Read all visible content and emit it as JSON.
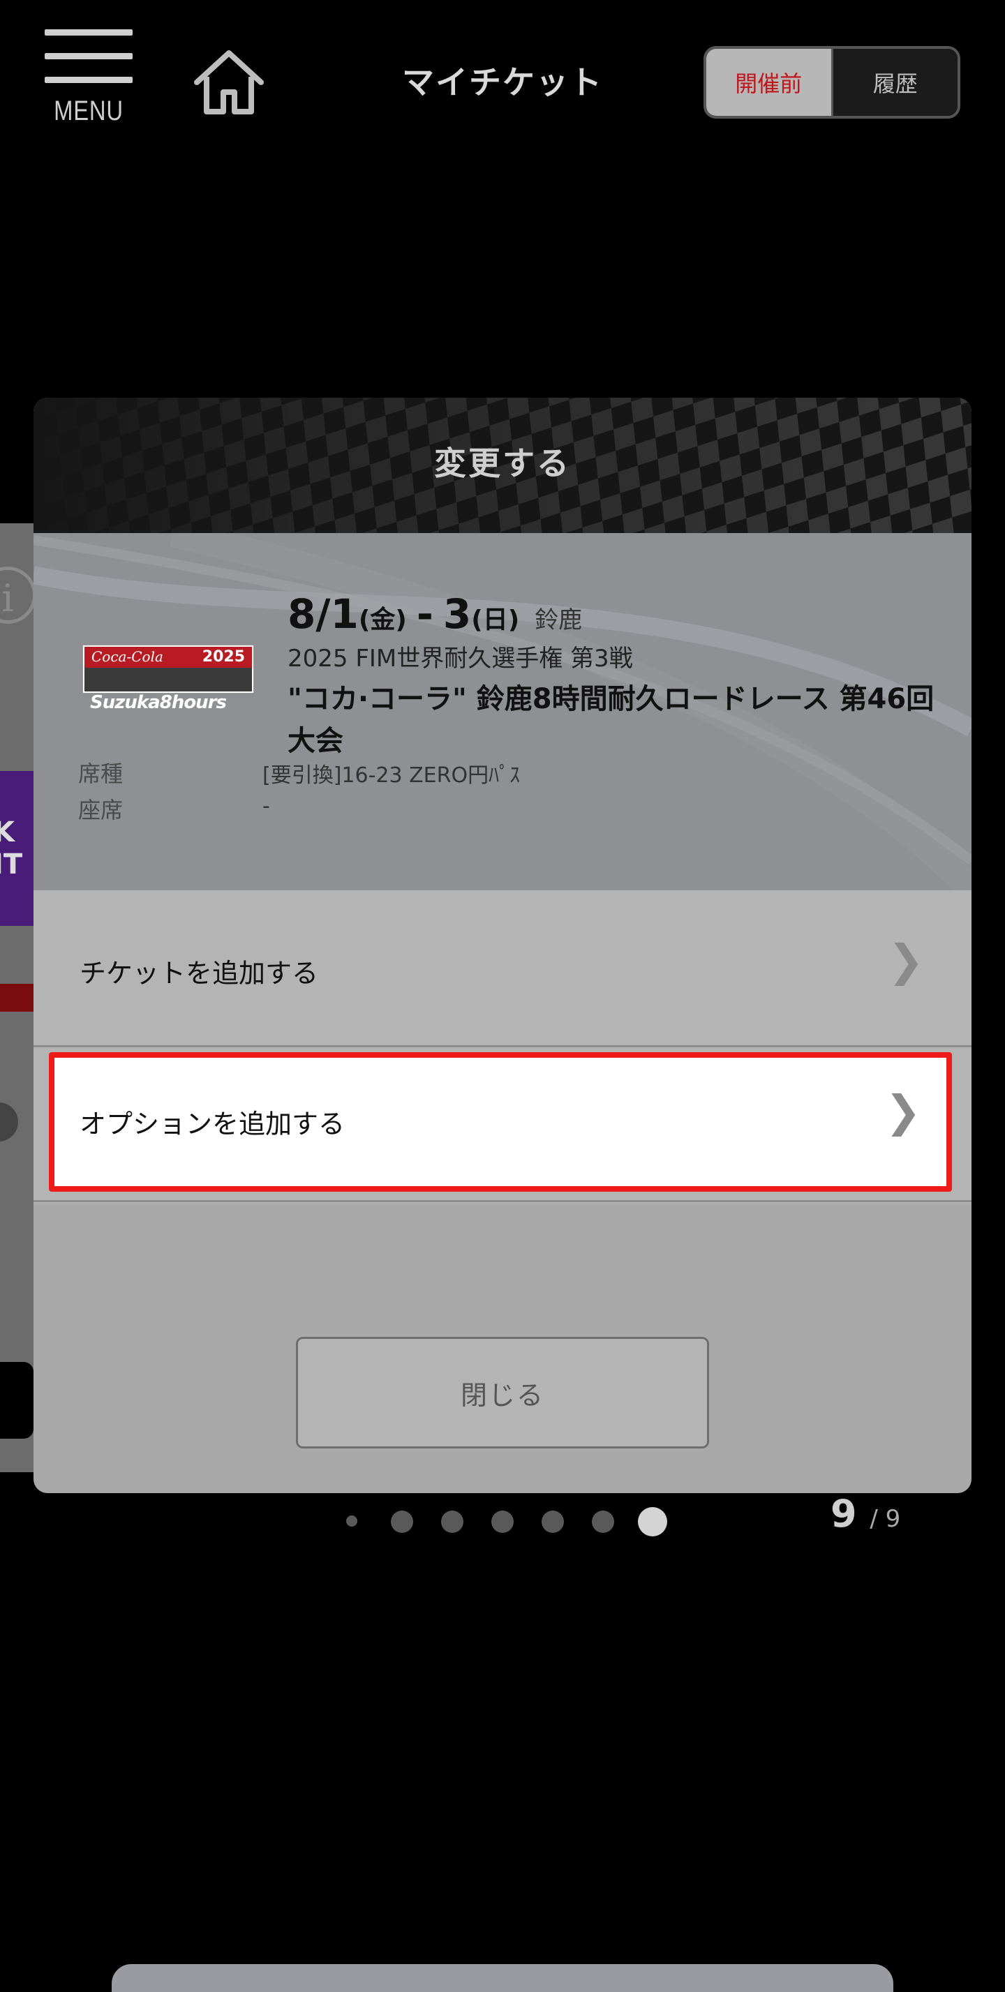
{
  "header": {
    "menu_label": "MENU",
    "title": "マイチケット",
    "tabs": [
      {
        "label": "開催前",
        "active": true
      },
      {
        "label": "履歴",
        "active": false
      }
    ]
  },
  "modal": {
    "title": "変更する",
    "logo": {
      "brand": "Coca-Cola",
      "year": "2025",
      "name": "Suzuka8hours"
    },
    "event": {
      "date_start": "8/1",
      "dow_start": "(金)",
      "dash": "-",
      "date_end": "3",
      "dow_end": "(日)",
      "venue": "鈴鹿",
      "series": "2025 FIM世界耐久選手権 第3戦",
      "title": "\"コカ·コーラ\" 鈴鹿8時間耐久ロードレース 第46回大会"
    },
    "seat_type_label": "席種",
    "seat_type_value": "[要引換]16-23 ZERO円ﾊﾟｽ",
    "seat_label": "座席",
    "seat_value": "-",
    "actions": [
      {
        "label": "チケットを追加する"
      },
      {
        "label": "オプションを追加する",
        "highlighted": true
      }
    ],
    "close_label": "閉じる"
  },
  "pagination": {
    "current": "9",
    "total": "/ 9",
    "dot_count": 7,
    "active_index": 6
  },
  "colors": {
    "accent_red": "#c0161b",
    "highlight_border": "#ee1b1b"
  }
}
